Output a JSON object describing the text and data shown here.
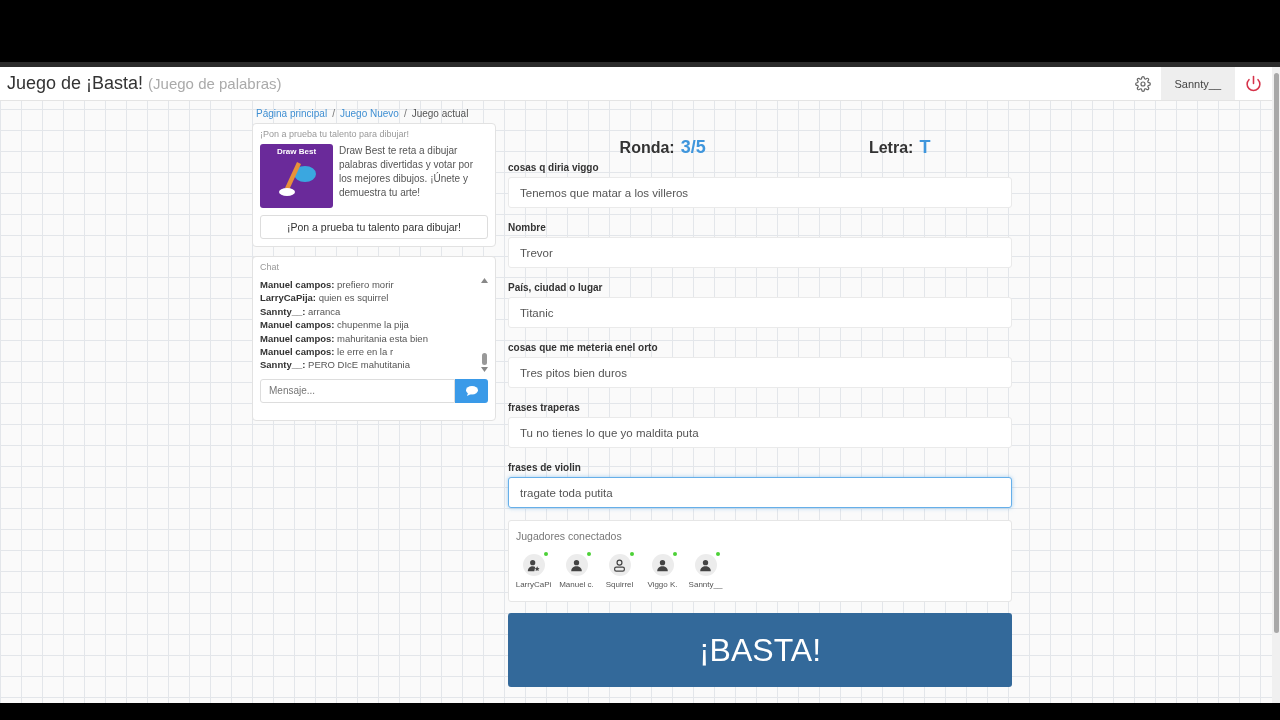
{
  "header": {
    "title": "Juego de ¡Basta!",
    "subtitle": "(Juego de palabras)",
    "user": "Sannty__"
  },
  "breadcrumb": [
    {
      "label": "Página principal",
      "link": true
    },
    {
      "separator": "/",
      "label": "Juego Nuevo",
      "link": true
    },
    {
      "separator": "/",
      "label": "Juego actual",
      "link": false
    }
  ],
  "promo": {
    "heading": "¡Pon a prueba tu talento para dibujar!",
    "image_title": "Draw Best",
    "text": "Draw Best te reta a dibujar palabras divertidas y votar por los mejores dibujos. ¡Únete y demuestra tu arte!",
    "button": "¡Pon a prueba tu talento para dibujar!"
  },
  "chat": {
    "title": "Chat",
    "messages": [
      {
        "user": "Manuel campos:",
        "text": "prefiero morir"
      },
      {
        "user": "LarryCaPija:",
        "text": "quien es squirrel"
      },
      {
        "user": "Sannty__:",
        "text": "arranca"
      },
      {
        "user": "Manuel campos:",
        "text": "chupenme la pija"
      },
      {
        "user": "Manuel campos:",
        "text": "mahuritania esta bien"
      },
      {
        "user": "Manuel campos:",
        "text": "le erre en la r"
      },
      {
        "user": "Sannty__:",
        "text": "PERO DIcE mahutitania"
      }
    ],
    "placeholder": "Mensaje..."
  },
  "round": {
    "label": "Ronda:",
    "value": "3/5"
  },
  "letter": {
    "label": "Letra:",
    "value": "T"
  },
  "fields": [
    {
      "label": "cosas q diria viggo",
      "value": "Tenemos que matar a los villeros",
      "focused": false
    },
    {
      "label": "Nombre",
      "value": "Trevor",
      "focused": false
    },
    {
      "label": "País, ciudad o lugar",
      "value": "Titanic",
      "focused": false
    },
    {
      "label": "cosas que me meteria enel orto",
      "value": "Tres pitos bien duros",
      "focused": false
    },
    {
      "label": "frases traperas",
      "value": "Tu no tienes lo que yo maldita puta",
      "focused": false
    },
    {
      "label": "frases de violin",
      "value": "tragate toda putita",
      "focused": true
    }
  ],
  "players": {
    "title": "Jugadores conectados",
    "items": [
      {
        "name": "LarryCaPi",
        "kind": "host",
        "online": true
      },
      {
        "name": "Manuel c.",
        "kind": "user",
        "online": true
      },
      {
        "name": "Squirrel",
        "kind": "outline",
        "online": true
      },
      {
        "name": "Viggo K.",
        "kind": "user",
        "online": true
      },
      {
        "name": "Sannty__",
        "kind": "user",
        "online": true
      }
    ]
  },
  "basta_button": "¡BASTA!"
}
